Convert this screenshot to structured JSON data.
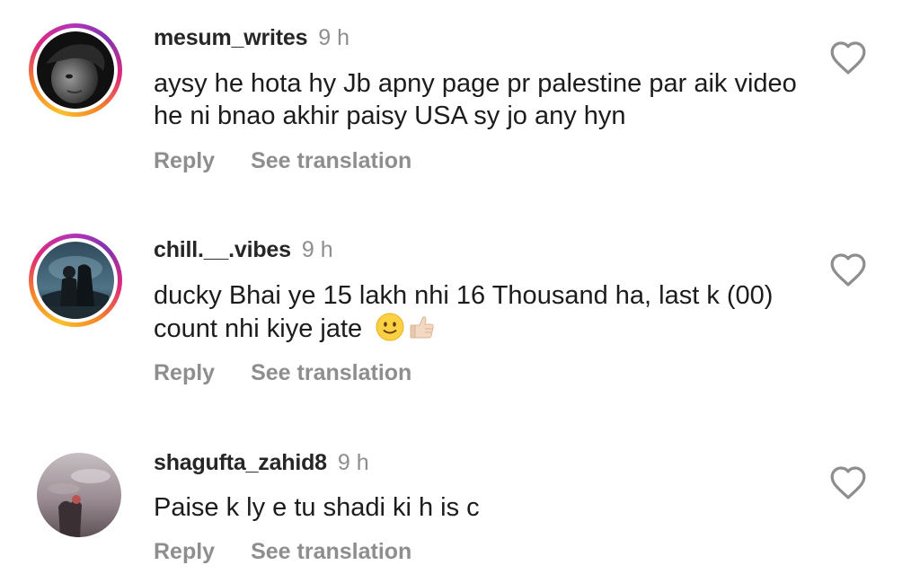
{
  "comments": [
    {
      "username": "mesum_writes",
      "time": "9 h",
      "text": "aysy he  hota hy Jb apny page pr palestine par aik video he ni bnao akhir paisy USA sy jo any hyn",
      "reply_label": "Reply",
      "translate_label": "See translation",
      "has_story_ring": true
    },
    {
      "username": "chill.__.vibes",
      "time": "9 h",
      "text": "ducky Bhai ye 15 lakh nhi 16 Thousand ha, last k (00) count nhi kiye jate",
      "emojis": [
        "slightly-smiling-face",
        "thumbs-up"
      ],
      "reply_label": "Reply",
      "translate_label": "See translation",
      "has_story_ring": true
    },
    {
      "username": "shagufta_zahid8",
      "time": "9 h",
      "text": "Paise k ly e tu shadi ki h is c",
      "reply_label": "Reply",
      "translate_label": "See translation",
      "has_story_ring": false
    }
  ],
  "icons": {
    "like": "heart-outline-icon"
  },
  "colors": {
    "username": "#262626",
    "secondary_text": "#8e8e8e",
    "body_text": "#1c1c1c",
    "ring_gradient": [
      "#f9c02c",
      "#f58529",
      "#dd2a7b",
      "#8134af"
    ]
  }
}
